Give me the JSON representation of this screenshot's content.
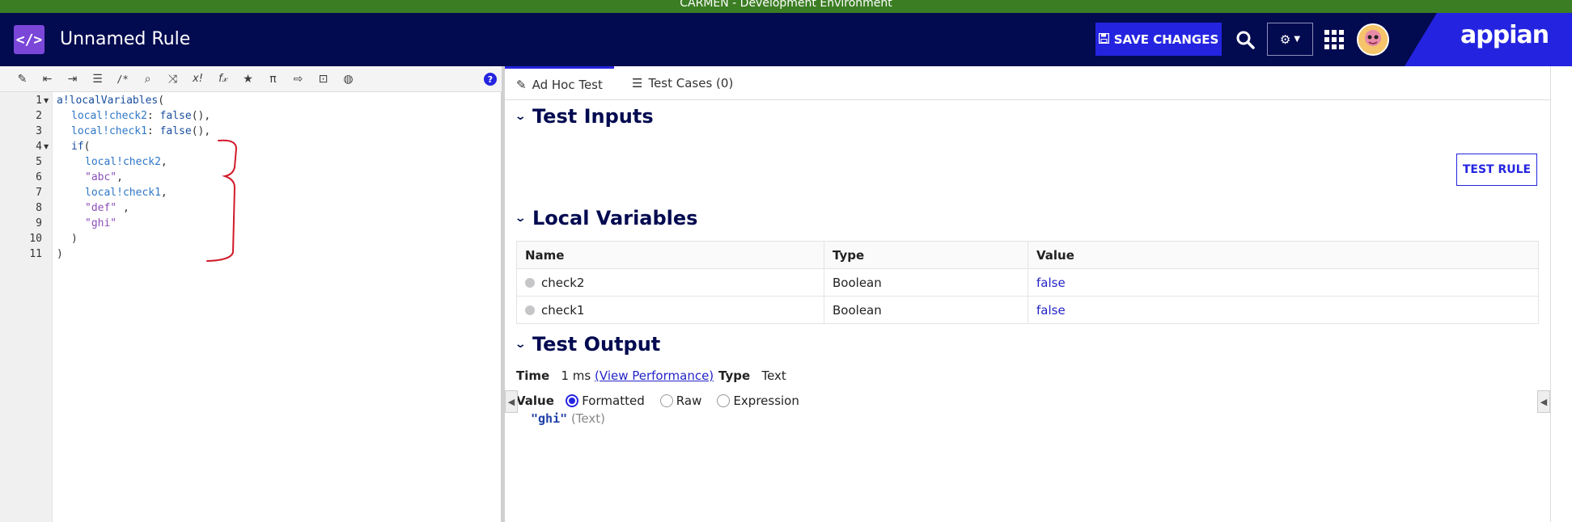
{
  "environment_bar": "CARMEN - Development Environment",
  "header": {
    "title": "Unnamed Rule",
    "save_label": "SAVE CHANGES",
    "logo": "appian"
  },
  "code_lines": [
    {
      "n": "1",
      "fold": true
    },
    {
      "n": "2",
      "fold": false
    },
    {
      "n": "3",
      "fold": false
    },
    {
      "n": "4",
      "fold": true
    },
    {
      "n": "5",
      "fold": false
    },
    {
      "n": "6",
      "fold": false
    },
    {
      "n": "7",
      "fold": false
    },
    {
      "n": "8",
      "fold": false
    },
    {
      "n": "9",
      "fold": false
    },
    {
      "n": "10",
      "fold": false
    },
    {
      "n": "11",
      "fold": false
    }
  ],
  "code": {
    "l1_fn": "a!localVariables",
    "l1_p": "(",
    "l2_var": "local!check2",
    "l2_rest": ": ",
    "l2_fn": "false",
    "l2_end": "(),",
    "l3_var": "local!check1",
    "l3_rest": ": ",
    "l3_fn": "false",
    "l3_end": "(),",
    "l4_fn": "if",
    "l4_p": "(",
    "l5_var": "local!check2",
    "l5_p": ",",
    "l6_str": "\"abc\"",
    "l6_p": ",",
    "l7_var": "local!check1",
    "l7_p": ",",
    "l8_str": "\"def\"",
    "l8_p": " ,",
    "l9_str": "\"ghi\"",
    "l10": ")",
    "l11": ")"
  },
  "tabs": {
    "adhoc": "Ad Hoc Test",
    "cases": "Test Cases (0)"
  },
  "sections": {
    "inputs": "Test Inputs",
    "locals": "Local Variables",
    "output": "Test Output"
  },
  "test_rule_label": "TEST RULE",
  "local_vars": {
    "headers": [
      "Name",
      "Type",
      "Value"
    ],
    "rows": [
      {
        "name": "check2",
        "type": "Boolean",
        "value": "false"
      },
      {
        "name": "check1",
        "type": "Boolean",
        "value": "false"
      }
    ]
  },
  "output": {
    "time_label": "Time",
    "time_value": "1 ms",
    "perf_link": "(View Performance)",
    "type_label": "Type",
    "type_value": "Text",
    "value_label": "Value",
    "modes": [
      "Formatted",
      "Raw",
      "Expression"
    ],
    "selected_mode": "Formatted",
    "result_value": "\"ghi\"",
    "result_type": "(Text)"
  },
  "colors": {
    "header_bg": "#020a50",
    "accent": "#2424e0",
    "env_bar": "#3b7d23",
    "rule_icon": "#7b47d9"
  }
}
